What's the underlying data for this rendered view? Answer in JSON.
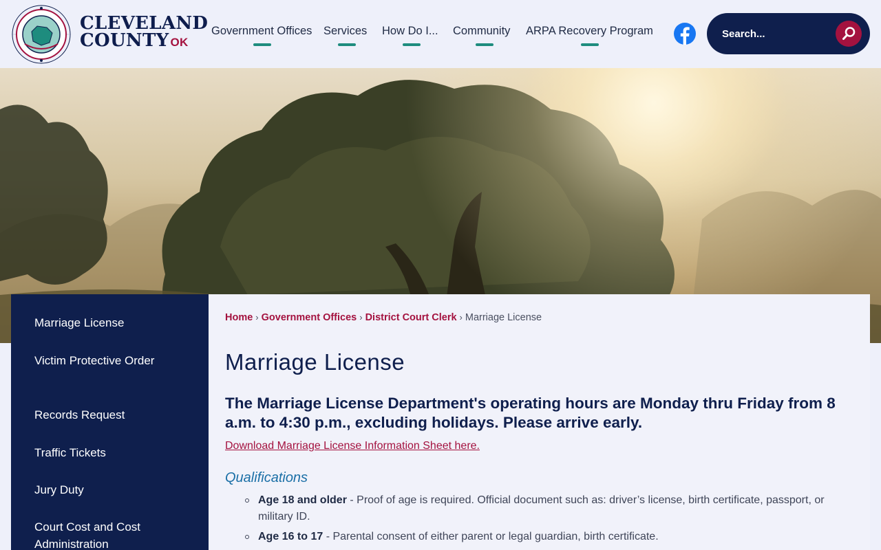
{
  "brand": {
    "seal_text_top": "CLEVELAND COUNTY",
    "seal_text_bottom": "OKLAHOMA",
    "name_line1": "CLEVELAND",
    "name_line2": "COUNTY",
    "state": "OK"
  },
  "nav": {
    "items": [
      {
        "label": "Government Offices"
      },
      {
        "label": "Services"
      },
      {
        "label": "How Do I..."
      },
      {
        "label": "Community"
      },
      {
        "label": "ARPA Recovery Program"
      }
    ],
    "facebook_icon": "facebook-icon"
  },
  "search": {
    "placeholder": "Search...",
    "icon": "search-icon"
  },
  "sidebar": {
    "items": [
      {
        "label": "Marriage License"
      },
      {
        "label": "Victim Protective Order"
      },
      {
        "label": "Records Request"
      },
      {
        "label": "Traffic Tickets"
      },
      {
        "label": "Jury Duty"
      },
      {
        "label": "Court Cost and Cost Administration"
      }
    ]
  },
  "breadcrumb": {
    "items": [
      {
        "label": "Home"
      },
      {
        "label": "Government Offices"
      },
      {
        "label": "District Court Clerk"
      }
    ],
    "current": "Marriage License"
  },
  "main": {
    "title": "Marriage License",
    "hours": "The Marriage License Department's operating hours are Monday thru Friday from 8 a.m. to 4:30 p.m., excluding holidays. Please arrive early.",
    "download_link": "Download Marriage License Information Sheet here.",
    "qualifications_heading": "Qualifications",
    "qualifications": [
      {
        "term": "Age 18 and older",
        "text": " - Proof of age is required. Official document such as: driver’s license, birth certificate, passport, or military ID."
      },
      {
        "term": "Age 16 to 17",
        "text": " - Parental consent of either parent or legal guardian, birth certificate."
      }
    ]
  },
  "colors": {
    "navy": "#0f1f4d",
    "crimson": "#a4123f",
    "teal": "#1e8c7e",
    "background": "#eef0fa"
  }
}
